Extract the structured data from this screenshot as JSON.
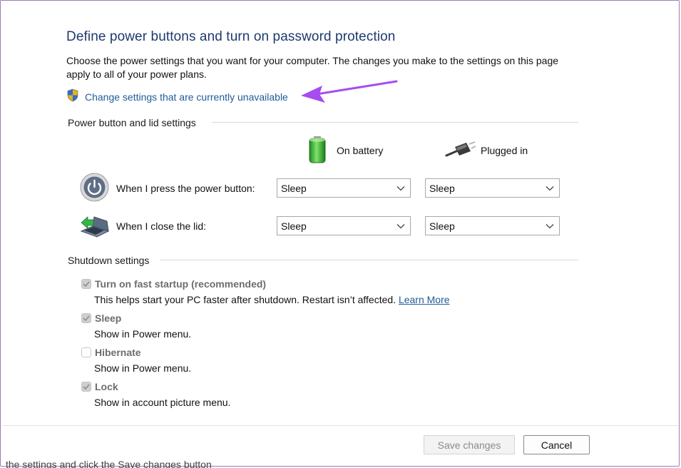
{
  "header": {
    "title": "Define power buttons and turn on password protection",
    "description": "Choose the power settings that you want for your computer. The changes you make to the settings on this page apply to all of your power plans.",
    "change_link": "Change settings that are currently unavailable",
    "shield_icon": "uac-shield-icon",
    "annotation_color": "#a64cf0"
  },
  "power_section": {
    "title": "Power button and lid settings",
    "col_battery": "On battery",
    "col_plugged": "Plugged in",
    "rows": [
      {
        "label": "When I press the power button:",
        "icon": "power-button-icon",
        "battery": "Sleep",
        "plugged": "Sleep"
      },
      {
        "label": "When I close the lid:",
        "icon": "laptop-lid-icon",
        "battery": "Sleep",
        "plugged": "Sleep"
      }
    ]
  },
  "shutdown_section": {
    "title": "Shutdown settings",
    "items": [
      {
        "label": "Turn on fast startup (recommended)",
        "sub": "This helps start your PC faster after shutdown. Restart isn’t affected.",
        "link": "Learn More",
        "checked": true
      },
      {
        "label": "Sleep",
        "sub": "Show in Power menu.",
        "checked": true
      },
      {
        "label": "Hibernate",
        "sub": "Show in Power menu.",
        "checked": false
      },
      {
        "label": "Lock",
        "sub": "Show in account picture menu.",
        "checked": true
      }
    ]
  },
  "footer": {
    "save_label": "Save changes",
    "cancel_label": "Cancel",
    "cutoff_text": "the settings and click the Save changes button"
  }
}
